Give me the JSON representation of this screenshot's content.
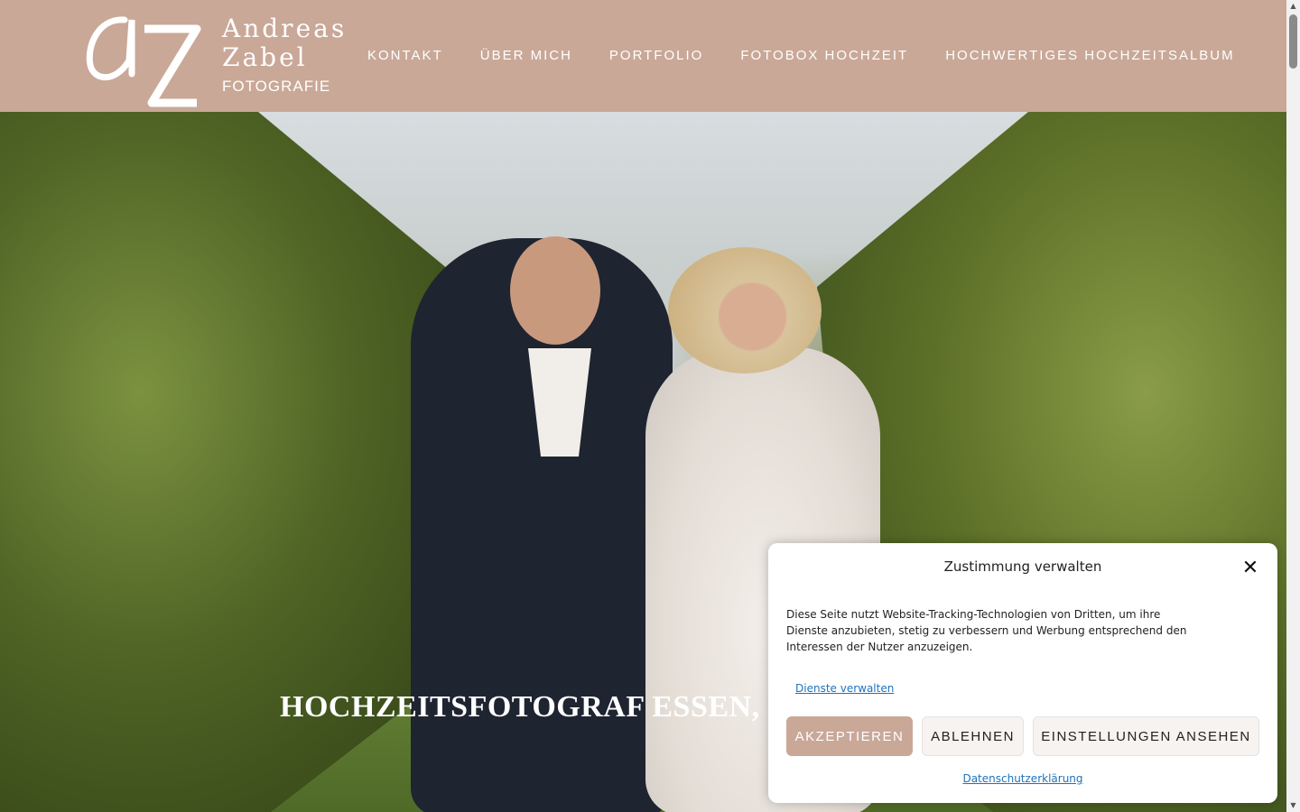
{
  "header": {
    "logo": {
      "monogram": "aZ",
      "name_line1": "Andreas",
      "name_line2": "Zabel",
      "subtitle": "FOTOGRAFIE"
    },
    "nav": [
      {
        "label": "KONTAKT"
      },
      {
        "label": "ÜBER MICH"
      },
      {
        "label": "PORTFOLIO"
      },
      {
        "label": "FOTOBOX HOCHZEIT"
      },
      {
        "label": "HOCHWERTIGES HOCHZEITSALBUM"
      }
    ]
  },
  "hero": {
    "title": "HOCHZEITSFOTOGRAF ESSEN, RUHR"
  },
  "consent": {
    "title": "Zustimmung verwalten",
    "close_icon": "close-icon",
    "text": "Diese Seite nutzt Website-Tracking-Technologien von Dritten, um ihre Dienste anzubieten, stetig zu verbessern und Werbung entsprechend den Interessen der Nutzer anzuzeigen.",
    "manage_link": "Dienste verwalten",
    "accept_label": "AKZEPTIEREN",
    "deny_label": "ABLEHNEN",
    "preferences_label": "EINSTELLUNGEN ANSEHEN",
    "privacy_link": "Datenschutzerklärung"
  },
  "colors": {
    "brand": "#c9a898",
    "link": "#1e73be"
  }
}
